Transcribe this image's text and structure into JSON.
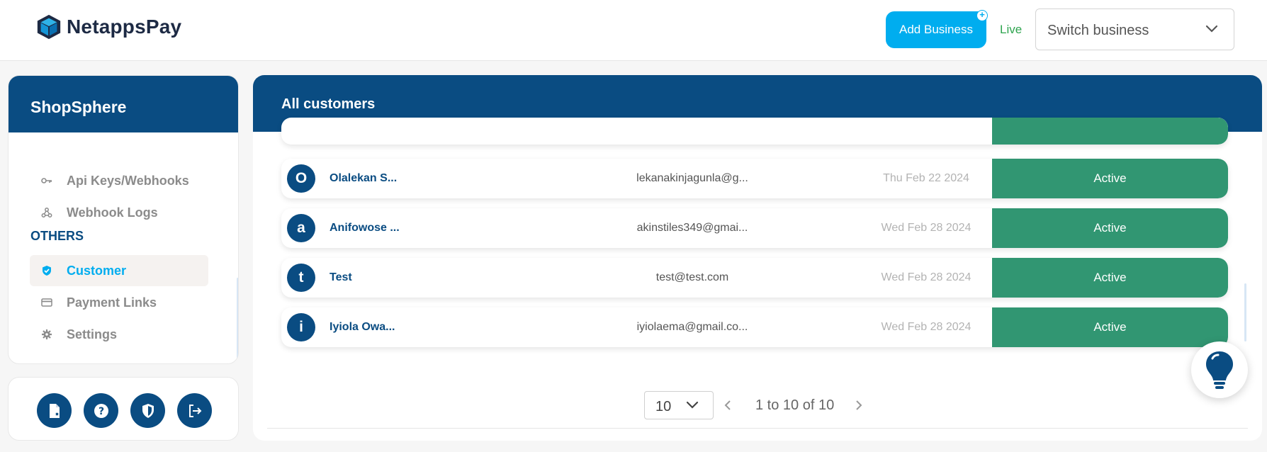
{
  "brand": {
    "name": "NetappsPay"
  },
  "topbar": {
    "add_business_label": "Add Business",
    "env_label": "Live",
    "switch_business_placeholder": "Switch business"
  },
  "sidebar": {
    "business_name": "ShopSphere",
    "items_top": [
      {
        "label": "Api Keys/Webhooks",
        "icon": "key-icon"
      },
      {
        "label": "Webhook Logs",
        "icon": "webhook-icon"
      }
    ],
    "section_title": "OTHERS",
    "items_others": [
      {
        "label": "Customer",
        "icon": "shield-check-icon",
        "active": true
      },
      {
        "label": "Payment Links",
        "icon": "card-icon"
      },
      {
        "label": "Settings",
        "icon": "gear-icon"
      }
    ],
    "actions": [
      "document-icon",
      "help-icon",
      "security-icon",
      "logout-icon"
    ]
  },
  "main": {
    "title": "All customers",
    "customers": [
      {
        "initial": "O",
        "name": "Olalekan S...",
        "email": "lekanakinjagunla@g...",
        "date": "Thu Feb 22 2024",
        "status": "Active"
      },
      {
        "initial": "a",
        "name": "Anifowose ...",
        "email": "akinstiles349@gmai...",
        "date": "Wed Feb 28 2024",
        "status": "Active"
      },
      {
        "initial": "t",
        "name": "Test",
        "email": "test@test.com",
        "date": "Wed Feb 28 2024",
        "status": "Active"
      },
      {
        "initial": "i",
        "name": "Iyiola Owa...",
        "email": "iyiolaema@gmail.co...",
        "date": "Wed Feb 28 2024",
        "status": "Active"
      }
    ],
    "pagination": {
      "per_page": "10",
      "range_text": "1 to 10 of 10"
    }
  },
  "colors": {
    "primary": "#0a4c82",
    "accent": "#00adef",
    "status_active": "#319672",
    "live": "#2ea44f"
  }
}
